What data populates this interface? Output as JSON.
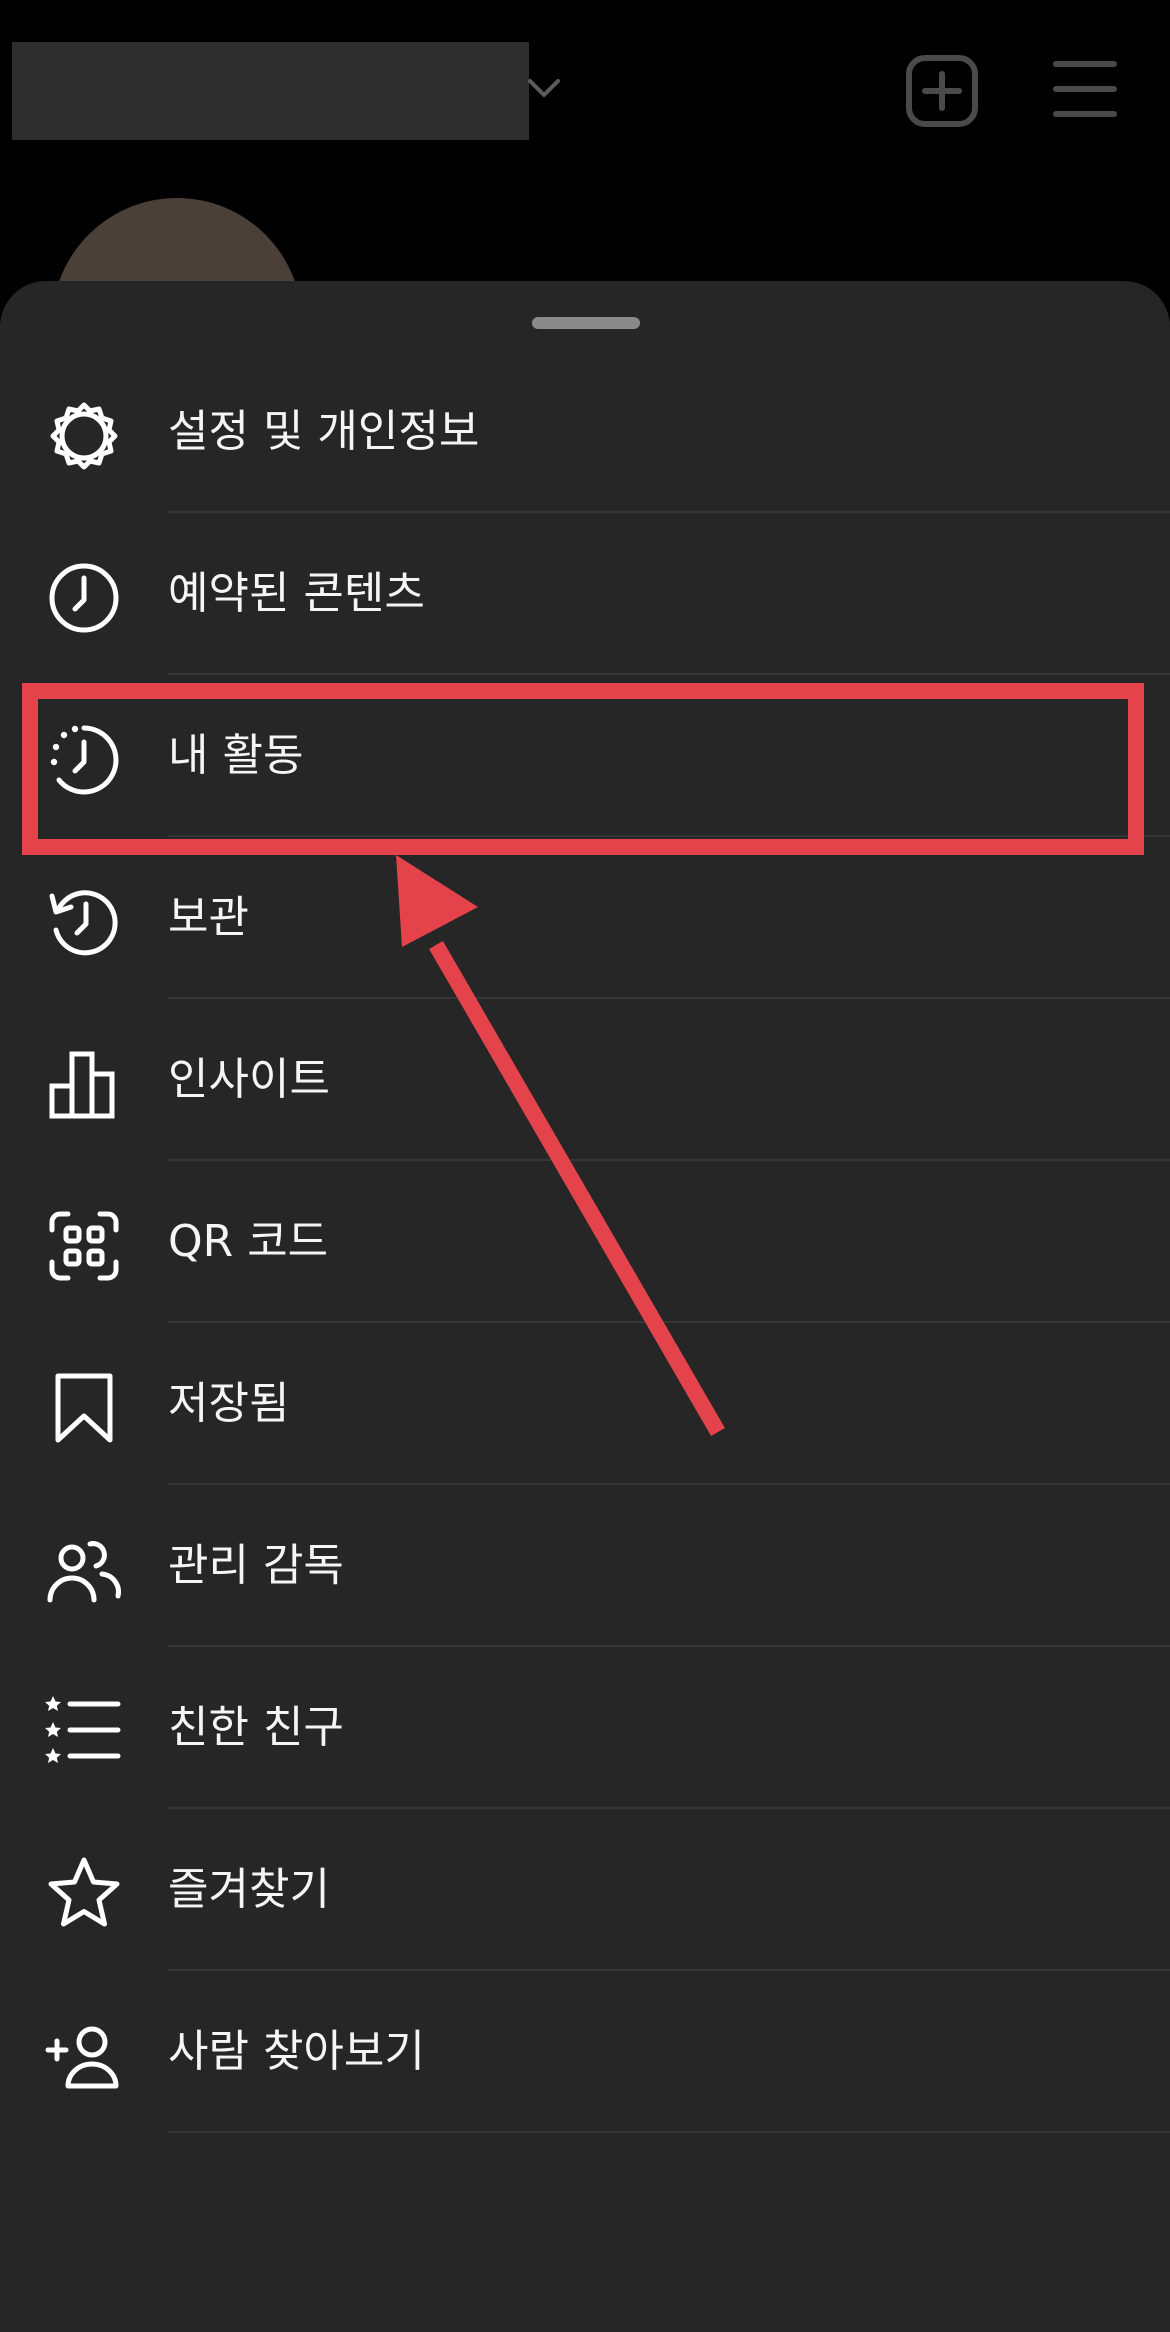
{
  "header": {
    "account_dropdown_icon": "chevron-down-icon",
    "create_icon": "plus-square-icon",
    "menu_icon": "hamburger-menu-icon"
  },
  "menu": {
    "items": [
      {
        "label": "설정 및 개인정보",
        "icon": "settings-gear-icon"
      },
      {
        "label": "예약된 콘텐츠",
        "icon": "clock-icon"
      },
      {
        "label": "내 활동",
        "icon": "activity-clock-icon"
      },
      {
        "label": "보관",
        "icon": "archive-history-icon"
      },
      {
        "label": "인사이트",
        "icon": "bar-chart-icon"
      },
      {
        "label": "QR 코드",
        "icon": "qr-code-scan-icon"
      },
      {
        "label": "저장됨",
        "icon": "bookmark-icon"
      },
      {
        "label": "관리 감독",
        "icon": "people-icon"
      },
      {
        "label": "친한 친구",
        "icon": "star-list-icon"
      },
      {
        "label": "즐겨찾기",
        "icon": "star-icon"
      },
      {
        "label": "사람 찾아보기",
        "icon": "add-person-icon"
      }
    ],
    "highlighted_item_index": 2
  },
  "colors": {
    "page_background": "#000000",
    "sheet_background": "#262626",
    "text": "#f5f5f5",
    "divider": "#363636",
    "annotation": "#e5434b"
  }
}
